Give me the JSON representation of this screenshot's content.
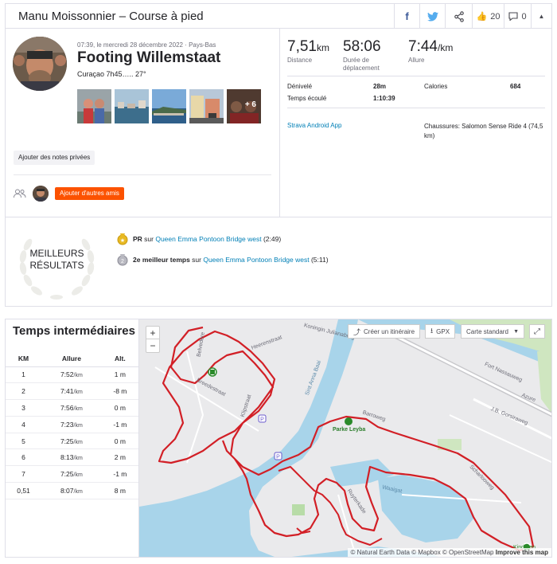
{
  "header": {
    "title": "Manu Moissonnier – Course à pied",
    "kudos_count": "20",
    "comments_count": "0"
  },
  "activity": {
    "meta": "07:39, le mercredi 28 décembre 2022 · Pays-Bas",
    "title": "Footing Willemstaat",
    "description": "Curaçao 7h45….. 27°",
    "photos_more": "+ 6",
    "notes_button": "Ajouter des notes privées",
    "friends_button": "Ajouter d'autres amis"
  },
  "stats": {
    "distance_value": "7,51",
    "distance_unit": "km",
    "distance_label": "Distance",
    "moving_value": "58:06",
    "moving_label": "Durée de déplacement",
    "pace_value": "7:44",
    "pace_unit": "/km",
    "pace_label": "Allure",
    "elev_label": "Dénivelé",
    "elev_value": "28m",
    "elapsed_label": "Temps écoulé",
    "elapsed_value": "1:10:39",
    "calories_label": "Calories",
    "calories_value": "684",
    "device": "Strava Android App",
    "shoes": "Chaussures: Salomon Sense Ride 4 (74,5 km)"
  },
  "best": {
    "title_line1": "MEILLEURS",
    "title_line2": "RÉSULTATS",
    "items": [
      {
        "rank": "PR",
        "mid": " sur ",
        "segment": "Queen Emma Pontoon Bridge west",
        "time": " (2:49)"
      },
      {
        "rank": "2e meilleur temps",
        "mid": " sur ",
        "segment": "Queen Emma Pontoon Bridge west",
        "time": " (5:11)"
      }
    ]
  },
  "splits": {
    "title": "Temps intermédiaires",
    "headers": [
      "KM",
      "Allure",
      "Alt."
    ],
    "unit": "/km",
    "rows": [
      {
        "km": "1",
        "pace": "7:52",
        "alt": "1 m"
      },
      {
        "km": "2",
        "pace": "7:41",
        "alt": "-8 m"
      },
      {
        "km": "3",
        "pace": "7:56",
        "alt": "0 m"
      },
      {
        "km": "4",
        "pace": "7:23",
        "alt": "-1 m"
      },
      {
        "km": "5",
        "pace": "7:25",
        "alt": "0 m"
      },
      {
        "km": "6",
        "pace": "8:13",
        "alt": "2 m"
      },
      {
        "km": "7",
        "pace": "7:25",
        "alt": "-1 m"
      },
      {
        "km": "0,51",
        "pace": "8:07",
        "alt": "8 m"
      }
    ]
  },
  "map": {
    "create_route": "Créer un itinéraire",
    "gpx": "GPX",
    "map_type": "Carte standard",
    "zoom_in": "+",
    "zoom_out": "−",
    "attribution": "© Natural Earth Data © Mapbox © OpenStreetMap",
    "improve": "Improve this map",
    "labels": {
      "koningin": "Koningin Julianabrug",
      "heerenstraat": "Heerenstraat",
      "breedestraat": "Breedestraat",
      "klipstraat": "Klipstraat",
      "belvedere": "Belvedere",
      "sint_anna": "Sint Anna Baai",
      "barroweg": "Barroweg",
      "parke_leyba": "Parke Leyba",
      "fort_nassau": "Fort Nassauweg",
      "jb_gorsira": "J.B. Gorsiraweg",
      "azure": "Azure",
      "waaigat": "Waaigat",
      "ruyterkade": "Ruyterkade",
      "scharloo": "Scharlooweg",
      "willemstad": "Kinderen"
    }
  },
  "colors": {
    "brand": "#fc5200",
    "link": "#007fb6",
    "route": "#d21f26"
  }
}
